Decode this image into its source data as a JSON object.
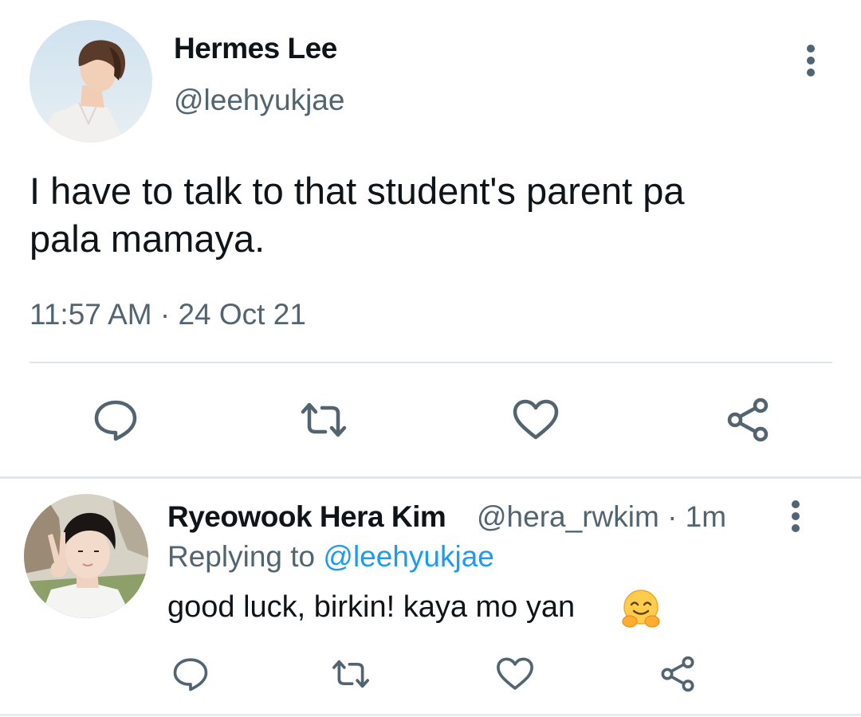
{
  "main_tweet": {
    "display_name": "Hermes Lee",
    "handle": "@leehyukjae",
    "text_line1": "I have to talk to that student's parent pa",
    "text_line2": "pala mamaya.",
    "timestamp": "11:57 AM · 24 Oct 21",
    "icons": [
      "avatar-photo",
      "more-vertical-icon",
      "reply-icon",
      "retweet-icon",
      "like-icon",
      "share-icon"
    ]
  },
  "reply": {
    "display_name": "Ryeowook Hera Kim",
    "handle": "@hera_rwkim",
    "separator": "·",
    "age": "1m",
    "replying_prefix": "Replying to",
    "replying_to": "@leehyukjae",
    "text": "good luck, birkin! kaya mo yan",
    "emoji": "hugging-face-emoji"
  },
  "colors": {
    "text": "#0f1419",
    "secondary": "#536471",
    "link": "#1d9bf0",
    "divider": "#e1e6ea"
  }
}
